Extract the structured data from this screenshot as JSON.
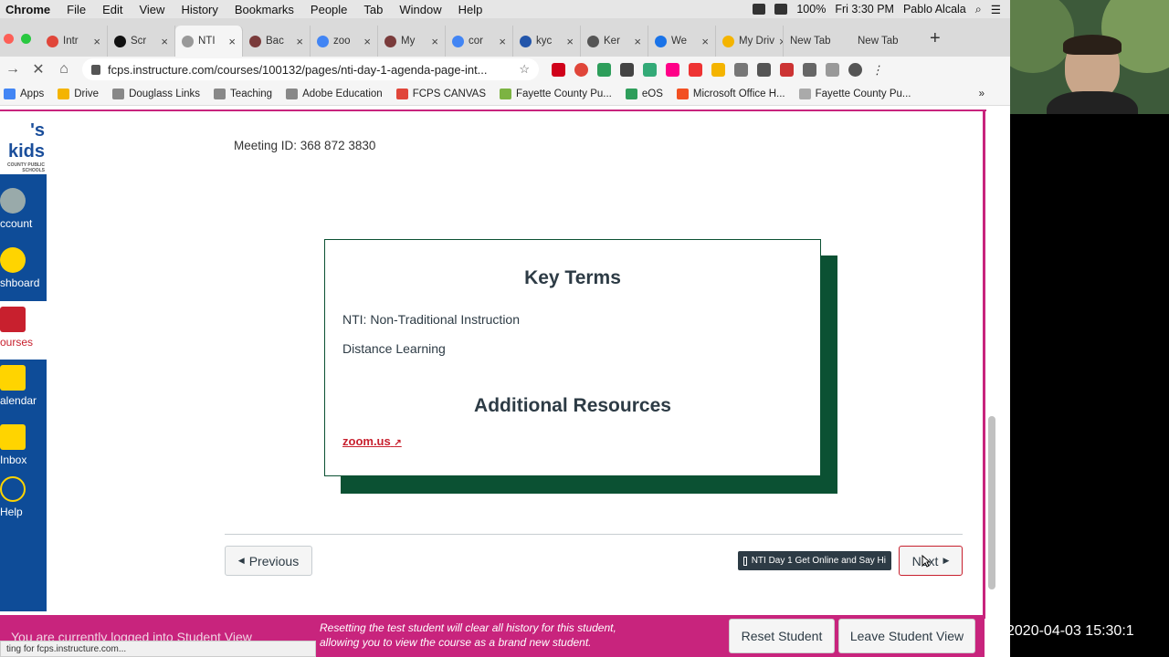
{
  "mac_menu": {
    "app": "Chrome",
    "items": [
      "File",
      "Edit",
      "View",
      "History",
      "Bookmarks",
      "People",
      "Tab",
      "Window",
      "Help"
    ],
    "battery": "100%",
    "clock": "Fri 3:30 PM",
    "user": "Pablo Alcala"
  },
  "tabs": [
    {
      "label": "Intr",
      "color": "#e0463a"
    },
    {
      "label": "Scr",
      "color": "#111111"
    },
    {
      "label": "NTI",
      "color": "#999999",
      "active": true
    },
    {
      "label": "Bac",
      "color": "#7a3b3b"
    },
    {
      "label": "zoo",
      "color": "#4285f4"
    },
    {
      "label": "My",
      "color": "#7a3b3b"
    },
    {
      "label": "cor",
      "color": "#4285f4"
    },
    {
      "label": "kyc",
      "color": "#2255aa"
    },
    {
      "label": "Ker",
      "color": "#555555"
    },
    {
      "label": "We",
      "color": "#1a73e8"
    },
    {
      "label": "My Driv",
      "color": "#f4b400"
    },
    {
      "label": "New Tab",
      "color": ""
    },
    {
      "label": "New Tab",
      "color": ""
    }
  ],
  "address": {
    "url": "fcps.instructure.com/courses/100132/pages/nti-day-1-agenda-page-int..."
  },
  "bookmarks": [
    {
      "label": "Apps",
      "color": "#4285f4"
    },
    {
      "label": "Drive",
      "color": "#f4b400"
    },
    {
      "label": "Douglass Links",
      "color": "#888888"
    },
    {
      "label": "Teaching",
      "color": "#888888"
    },
    {
      "label": "Adobe Education",
      "color": "#888888"
    },
    {
      "label": "FCPS CANVAS",
      "color": "#e0463a"
    },
    {
      "label": "Fayette County Pu...",
      "color": "#7cb342"
    },
    {
      "label": "eOS",
      "color": "#2e9e5b"
    },
    {
      "label": "Microsoft Office H...",
      "color": "#f25022"
    },
    {
      "label": "Fayette County Pu...",
      "color": "#aaaaaa"
    }
  ],
  "bookmarks_more": "»",
  "logo": {
    "text": "'s kids",
    "sub": "COUNTY PUBLIC SCHOOLS"
  },
  "global_nav": [
    {
      "label": "ccount",
      "icon": "account-icon"
    },
    {
      "label": "shboard",
      "icon": "dashboard-icon"
    },
    {
      "label": "ourses",
      "icon": "courses-icon",
      "current": true
    },
    {
      "label": "alendar",
      "icon": "calendar-icon"
    },
    {
      "label": "Inbox",
      "icon": "inbox-icon"
    },
    {
      "label": "Help",
      "icon": "help-icon"
    }
  ],
  "content": {
    "meeting_id": "Meeting ID: 368 872 3830",
    "key_terms_heading": "Key Terms",
    "term1": "NTI: Non-Traditional Instruction",
    "term2": "Distance Learning",
    "resources_heading": "Additional Resources",
    "resource_link": "zoom.us"
  },
  "pager": {
    "previous": "Previous",
    "next": "Next",
    "tooltip": "NTI Day 1 Get Online and Say Hi"
  },
  "student_view": {
    "message": "You are currently logged into Student View",
    "description": "Resetting the test student will clear all history for this student, allowing you to view the course as a brand new student.",
    "reset": "Reset Student",
    "leave": "Leave Student View"
  },
  "status_bar": "ting for fcps.instructure.com...",
  "timestamp": "2020-04-03 15:30:1",
  "colors": {
    "canvas_nav": "#0e4c98",
    "brand": "#c8247d",
    "card_accent": "#0b5133",
    "link": "#c8202e"
  }
}
